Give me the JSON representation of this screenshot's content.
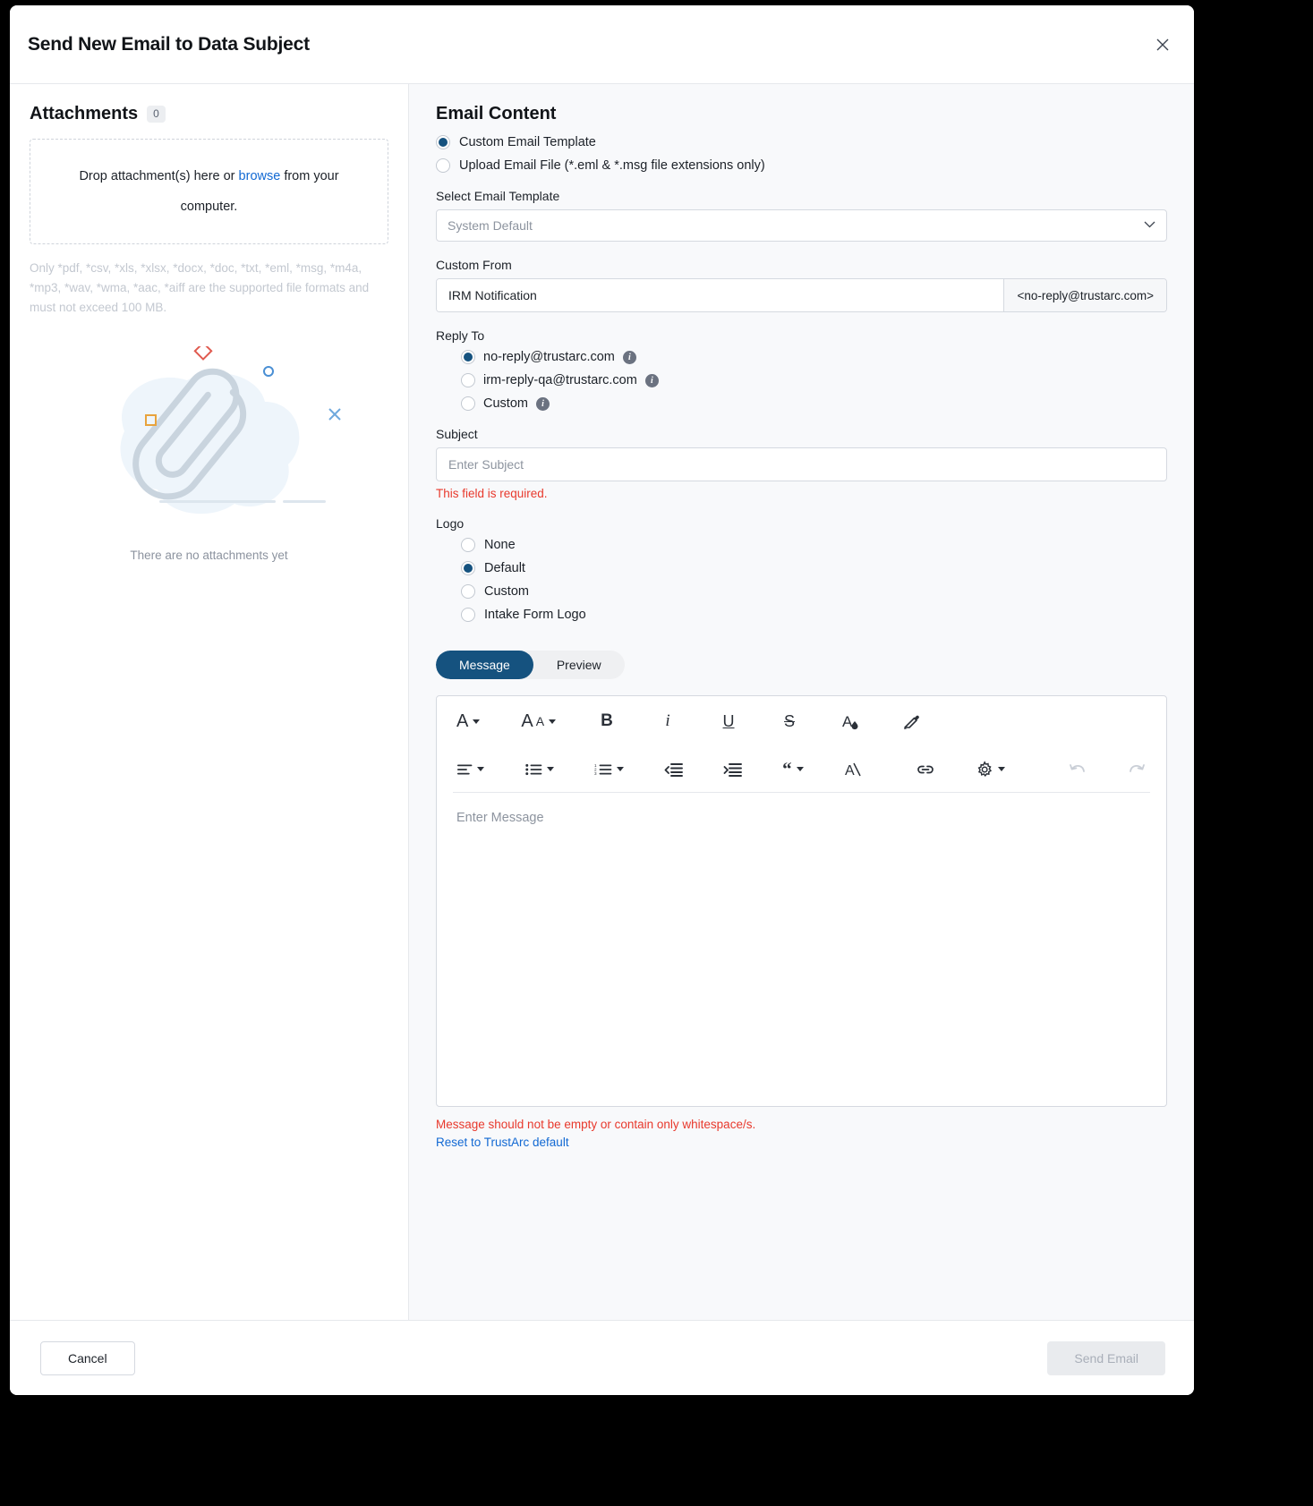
{
  "dialog": {
    "title": "Send New Email to Data Subject",
    "close_icon": "close-icon"
  },
  "attachments": {
    "title": "Attachments",
    "count": "0",
    "dropzone": {
      "text_before": "Drop attachment(s) here or ",
      "link": "browse",
      "text_after": " from your computer."
    },
    "formats_note": "Only *pdf, *csv, *xls, *xlsx, *docx, *doc, *txt, *eml, *msg, *m4a, *mp3, *wav, *wma, *aac, *aiff are the supported file formats and must not exceed 100 MB.",
    "empty_state": "There are no attachments yet"
  },
  "email_content": {
    "title": "Email Content",
    "source_options": [
      {
        "label": "Custom Email Template",
        "checked": true
      },
      {
        "label": "Upload Email File (*.eml & *.msg file extensions only)",
        "checked": false
      }
    ],
    "select_template": {
      "label": "Select Email Template",
      "value": "System Default",
      "chevron": "chevron-down-icon"
    },
    "custom_from": {
      "label": "Custom From",
      "value": "IRM Notification",
      "placeholder": "Custom From",
      "suffix": "<no-reply@trustarc.com>"
    },
    "reply_to": {
      "label": "Reply To",
      "options": [
        {
          "label": "no-reply@trustarc.com",
          "checked": true,
          "info": true
        },
        {
          "label": "irm-reply-qa@trustarc.com",
          "checked": false,
          "info": true
        },
        {
          "label": "Custom",
          "checked": false,
          "info": true
        }
      ]
    },
    "subject": {
      "label": "Subject",
      "value": "",
      "placeholder": "Enter Subject",
      "error": "This field is required."
    },
    "logo": {
      "label": "Logo",
      "options": [
        {
          "label": "None",
          "checked": false
        },
        {
          "label": "Default",
          "checked": true
        },
        {
          "label": "Custom",
          "checked": false
        },
        {
          "label": "Intake Form Logo",
          "checked": false
        }
      ]
    },
    "tabs": [
      {
        "label": "Message",
        "active": true
      },
      {
        "label": "Preview",
        "active": false
      }
    ],
    "editor": {
      "placeholder": "Enter Message",
      "toolbar_row1": [
        {
          "name": "font-family-icon",
          "glyph": "A",
          "caret": true
        },
        {
          "name": "font-size-icon",
          "glyph": "Aᴀ",
          "caret": true
        },
        {
          "name": "bold-icon",
          "glyph": "B",
          "caret": false
        },
        {
          "name": "italic-icon",
          "glyph": "i",
          "caret": false
        },
        {
          "name": "underline-icon",
          "glyph": "U",
          "caret": false
        },
        {
          "name": "strikethrough-icon",
          "glyph": "S",
          "caret": false
        },
        {
          "name": "font-color-icon",
          "glyph": "A",
          "caret": false
        },
        {
          "name": "highlight-color-icon",
          "glyph": "pen",
          "caret": false
        }
      ],
      "toolbar_row2": [
        {
          "name": "align-icon",
          "caret": true
        },
        {
          "name": "bulleted-list-icon",
          "caret": true
        },
        {
          "name": "numbered-list-icon",
          "caret": true
        },
        {
          "name": "outdent-icon",
          "caret": false
        },
        {
          "name": "indent-icon",
          "caret": false
        },
        {
          "name": "blockquote-icon",
          "caret": true
        },
        {
          "name": "clear-formatting-icon",
          "caret": false
        },
        {
          "name": "insert-link-icon",
          "caret": false
        },
        {
          "name": "settings-icon",
          "caret": true
        },
        {
          "name": "undo-icon",
          "caret": false
        },
        {
          "name": "redo-icon",
          "caret": false
        }
      ],
      "error": "Message should not be empty or contain only whitespace/s.",
      "reset_link": "Reset to TrustArc default"
    }
  },
  "footer": {
    "cancel": "Cancel",
    "send": "Send Email"
  },
  "colors": {
    "accent": "#15527f",
    "link": "#1269d3",
    "error": "#e8392c"
  }
}
